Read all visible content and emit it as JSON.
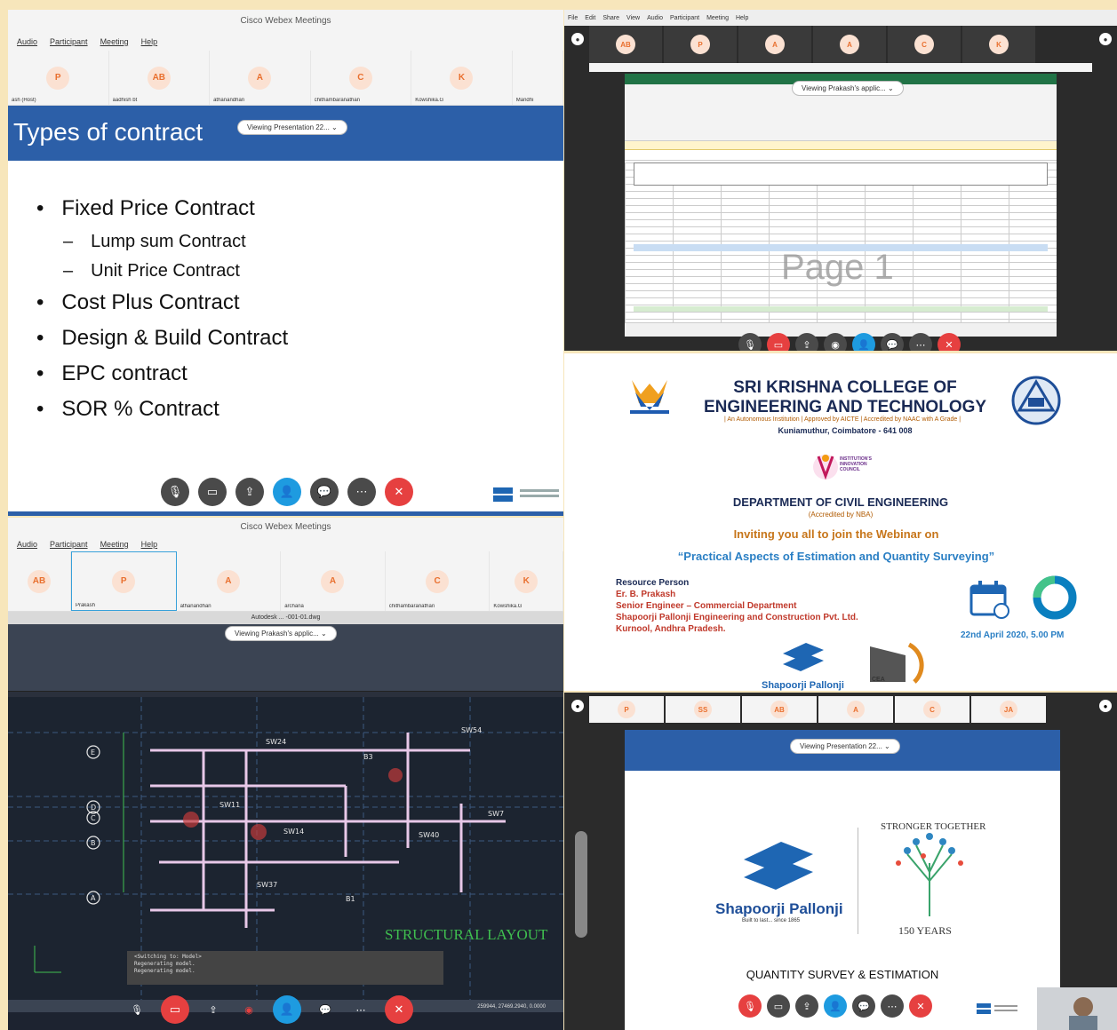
{
  "p1": {
    "window_title": "Cisco Webex Meetings",
    "menu": [
      "Audio",
      "Participant",
      "Meeting",
      "Help"
    ],
    "participants": [
      {
        "initials": "P",
        "name": "ash (Host)"
      },
      {
        "initials": "AB",
        "name": "aadhish bt"
      },
      {
        "initials": "A",
        "name": "athanandhan"
      },
      {
        "initials": "C",
        "name": "chithambaranathan"
      },
      {
        "initials": "K",
        "name": "Kowshika.G"
      },
      {
        "initials": "",
        "name": "Mandhi"
      }
    ],
    "viewing": "Viewing Presentation 22...",
    "slide_title": "Types of contract",
    "bullets": [
      {
        "mark": "•",
        "text": "Fixed Price Contract",
        "sub": false
      },
      {
        "mark": "–",
        "text": "Lump sum Contract",
        "sub": true
      },
      {
        "mark": "–",
        "text": "Unit Price Contract",
        "sub": true
      },
      {
        "mark": "•",
        "text": "Cost Plus Contract",
        "sub": false
      },
      {
        "mark": "•",
        "text": "Design & Build Contract",
        "sub": false
      },
      {
        "mark": "•",
        "text": "EPC contract",
        "sub": false
      },
      {
        "mark": "•",
        "text": "SOR % Contract",
        "sub": false
      }
    ]
  },
  "p2": {
    "menu": [
      "File",
      "Edit",
      "Share",
      "View",
      "Audio",
      "Participant",
      "Meeting",
      "Help"
    ],
    "participants": [
      {
        "initials": "AB"
      },
      {
        "initials": "P"
      },
      {
        "initials": "A"
      },
      {
        "initials": "A"
      },
      {
        "initials": "C"
      },
      {
        "initials": "K"
      }
    ],
    "viewing": "Viewing Prakash's applic...",
    "watermark": "Page 1"
  },
  "p3": {
    "college": "SRI KRISHNA COLLEGE OF ENGINEERING AND TECHNOLOGY",
    "affiliation": "| An Autonomous Institution | Approved by AICTE | Accredited by NAAC with A Grade |",
    "location": "Kuniamuthur, Coimbatore - 641 008",
    "iic": "INSTITUTION'S INNOVATION COUNCIL",
    "department": "DEPARTMENT OF CIVIL ENGINEERING",
    "accreditation": "(Accredited by NBA)",
    "invite": "Inviting you all to join the Webinar on",
    "topic": "“Practical Aspects of Estimation and Quantity Surveying”",
    "resource_label": "Resource Person",
    "speaker": "Er. B. Prakash",
    "designation": "Senior Engineer – Commercial Department",
    "company": "Shapoorji Pallonji Engineering and Construction Pvt. Ltd.",
    "city": "Kurnool, Andhra Pradesh.",
    "date": "22nd April 2020, 5.00 PM",
    "sp": "Shapoorji Pallonji",
    "cea": "CEA"
  },
  "p4": {
    "window_title": "Cisco Webex Meetings",
    "menu": [
      "Audio",
      "Participant",
      "Meeting",
      "Help"
    ],
    "participants": [
      {
        "initials": "AB",
        "name": ""
      },
      {
        "initials": "P",
        "name": "Prakash"
      },
      {
        "initials": "A",
        "name": "athanandhan"
      },
      {
        "initials": "A",
        "name": "archana"
      },
      {
        "initials": "C",
        "name": "chithambaranathan"
      },
      {
        "initials": "K",
        "name": "Kowshika.G"
      }
    ],
    "viewing": "Viewing Prakash's applic...",
    "cad_title": "Autodesk ... -001-01.dwg",
    "structural": "STRUCTURAL LAYOUT",
    "command_lines": [
      "<Switching to: Model>",
      "Regenerating model.",
      "Regenerating model."
    ],
    "coords": "259944, 27469.2940, 0.0000"
  },
  "p5": {
    "participants": [
      {
        "initials": "P"
      },
      {
        "initials": "SS"
      },
      {
        "initials": "AB"
      },
      {
        "initials": "A"
      },
      {
        "initials": "C"
      },
      {
        "initials": "JA"
      }
    ],
    "viewing": "Viewing Presentation 22...",
    "sp_name": "Shapoorji Pallonji",
    "sp_tag": "Built to last... since 1865",
    "years_top": "STRONGER TOGETHER",
    "years_bottom": "150 YEARS",
    "title": "QUANTITY SURVEY & ESTIMATION"
  }
}
